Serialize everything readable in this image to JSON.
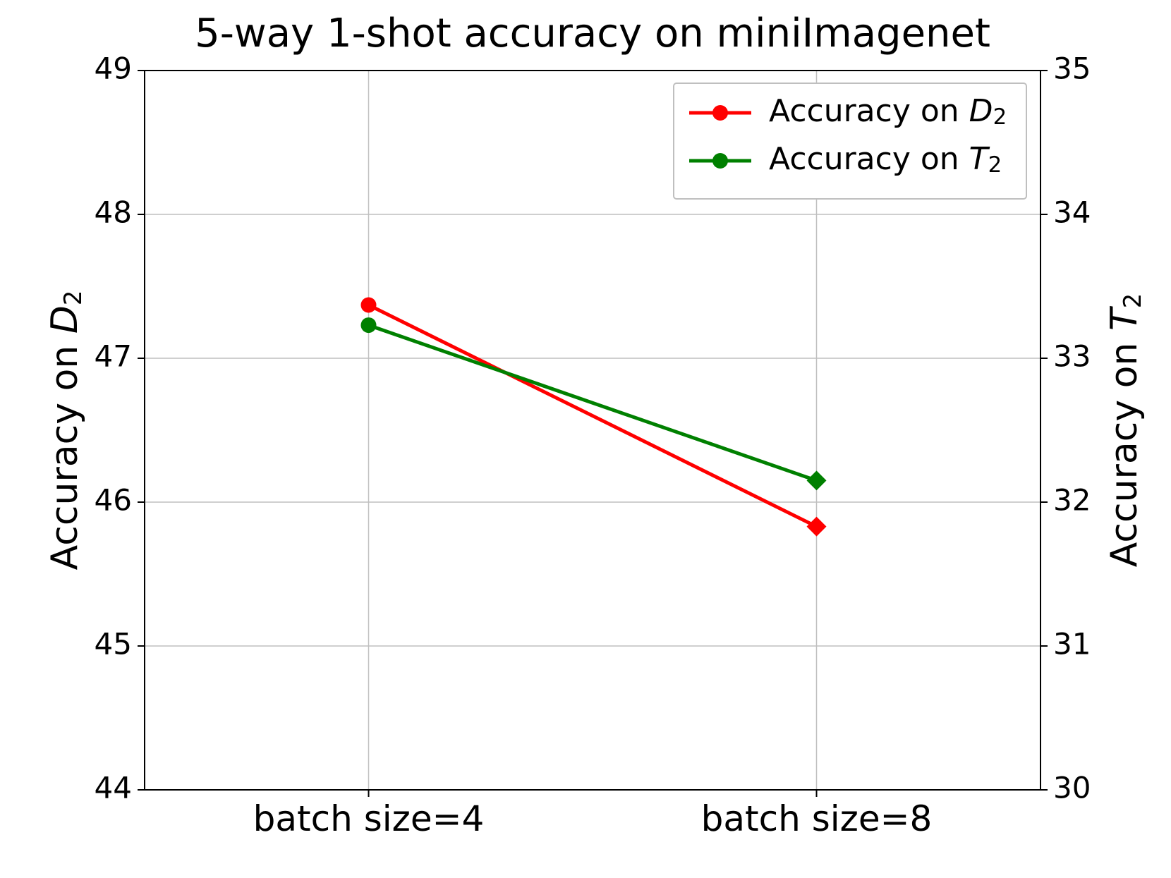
{
  "chart_data": {
    "type": "line",
    "title": "5-way 1-shot accuracy on miniImagenet",
    "categories": [
      "batch size=4",
      "batch size=8"
    ],
    "left_axis": {
      "label_prefix": "Accuracy on ",
      "label_var": "D",
      "label_sub": "2",
      "min": 44,
      "max": 49,
      "ticks": [
        44,
        45,
        46,
        47,
        48,
        49
      ]
    },
    "right_axis": {
      "label_prefix": "Accuracy on ",
      "label_var": "T",
      "label_sub": "2",
      "min": 30,
      "max": 35,
      "ticks": [
        30,
        31,
        32,
        33,
        34,
        35
      ]
    },
    "series": [
      {
        "name_prefix": "Accuracy on ",
        "name_var": "D",
        "name_sub": "2",
        "color": "#ff0000",
        "axis": "left",
        "values": [
          47.37,
          45.83
        ],
        "markers": [
          "circle",
          "diamond"
        ]
      },
      {
        "name_prefix": "Accuracy on ",
        "name_var": "T",
        "name_sub": "2",
        "color": "#008000",
        "axis": "right",
        "values": [
          33.23,
          32.15
        ],
        "markers": [
          "circle",
          "diamond"
        ]
      }
    ],
    "legend": {
      "position": "upper-right"
    }
  }
}
